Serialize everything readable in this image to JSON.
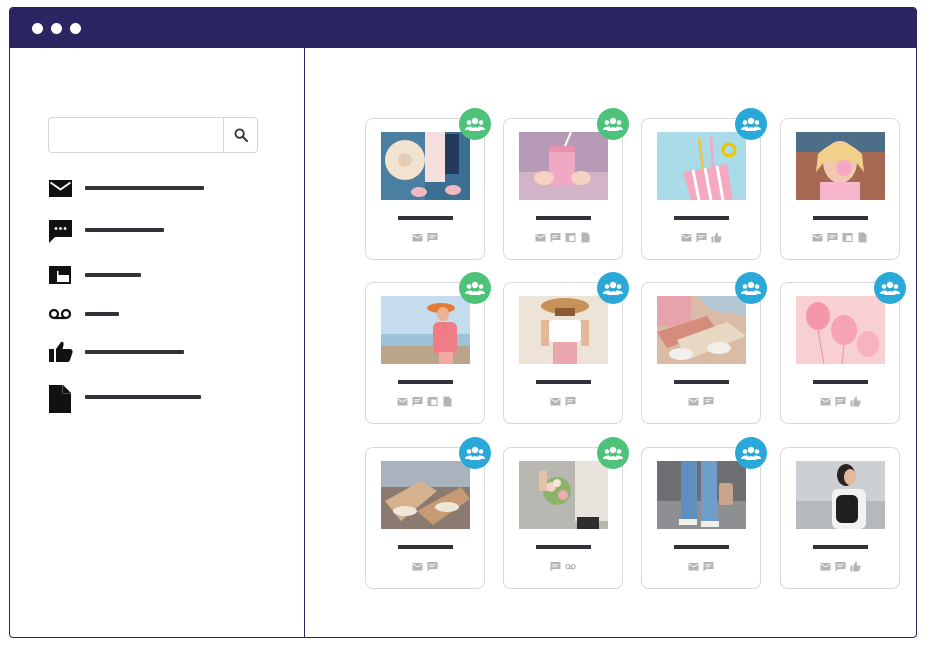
{
  "window": {
    "controls": [
      "dot",
      "dot",
      "dot"
    ],
    "colors": {
      "titlebar": "#2b2662",
      "text_bar": "#32323a",
      "icon_gray": "#b5b5b5"
    }
  },
  "search": {
    "value": "",
    "placeholder": "",
    "icon": "search-icon"
  },
  "sidebar": {
    "items": [
      {
        "icon": "mail-icon"
      },
      {
        "icon": "chat-bubble-icon"
      },
      {
        "icon": "web-layout-icon"
      },
      {
        "icon": "voicemail-icon"
      },
      {
        "icon": "thumbs-up-icon"
      },
      {
        "icon": "document-icon"
      }
    ]
  },
  "badge_colors": {
    "green": "#4ec27a",
    "blue": "#2aa9d8"
  },
  "cards": [
    {
      "photo": "hat-and-sandals",
      "badge": "green",
      "icons": [
        "mail-icon",
        "chat-icon"
      ]
    },
    {
      "photo": "pink-drink-jar",
      "badge": "green",
      "icons": [
        "mail-icon",
        "chat-icon",
        "web-icon",
        "document-icon"
      ]
    },
    {
      "photo": "popcorn-straws",
      "badge": "blue",
      "icons": [
        "mail-icon",
        "chat-icon",
        "thumbs-up-icon"
      ]
    },
    {
      "photo": "bubblegum-girl",
      "badge": "none",
      "icons": [
        "mail-icon",
        "chat-icon",
        "web-icon",
        "document-icon"
      ]
    },
    {
      "photo": "sea-hat-woman",
      "badge": "green",
      "icons": [
        "mail-icon",
        "chat-icon",
        "web-icon",
        "document-icon"
      ]
    },
    {
      "photo": "straw-hat-woman",
      "badge": "blue",
      "icons": [
        "mail-icon",
        "chat-icon"
      ]
    },
    {
      "photo": "friends-sneakers",
      "badge": "blue",
      "icons": [
        "mail-icon",
        "chat-icon"
      ]
    },
    {
      "photo": "pink-balloons",
      "badge": "blue",
      "icons": [
        "mail-icon",
        "chat-icon",
        "thumbs-up-icon"
      ]
    },
    {
      "photo": "sandals-shelf",
      "badge": "blue",
      "icons": [
        "mail-icon",
        "chat-icon"
      ]
    },
    {
      "photo": "flower-bouquet",
      "badge": "green",
      "icons": [
        "chat-icon",
        "voicemail-icon"
      ]
    },
    {
      "photo": "jeans-legs",
      "badge": "blue",
      "icons": [
        "mail-icon",
        "chat-icon"
      ]
    },
    {
      "photo": "backpack-woman",
      "badge": "none",
      "icons": [
        "mail-icon",
        "chat-icon",
        "thumbs-up-icon"
      ]
    }
  ]
}
